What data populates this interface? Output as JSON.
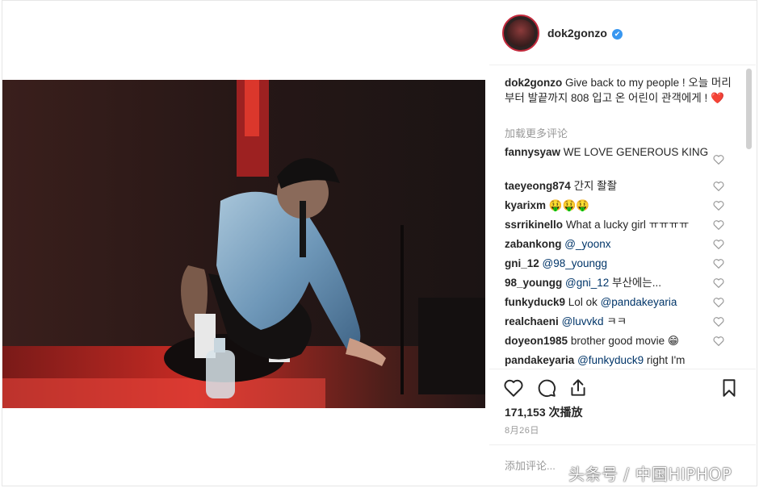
{
  "post": {
    "username": "dok2gonzo",
    "verified_mark": "✔",
    "caption_user": "dok2gonzo",
    "caption_text": "Give back to my people ! 오늘 머리 부터 발끝까지 808 입고 온 어린이 관객에게 !",
    "caption_emoji": "❤️",
    "load_more": "加载更多评论",
    "views": "171,153 次播放",
    "date": "8月26日",
    "add_comment_placeholder": "添加评论..."
  },
  "comments": [
    {
      "user": "fannysyaw",
      "text": "WE LOVE GENEROUS KING"
    },
    {
      "user": "taeyeong874",
      "text": "간지 좔좔"
    },
    {
      "user": "kyarixm",
      "text": "🤑🤑🤑"
    },
    {
      "user": "ssrrikinello",
      "text": "What a lucky girl ㅠㅠㅠㅠ"
    },
    {
      "user": "zabankong",
      "mention": "@_yoonx",
      "text": ""
    },
    {
      "user": "gni_12",
      "mention": "@98_youngg",
      "text": ""
    },
    {
      "user": "98_youngg",
      "mention": "@gni_12",
      "text": "부산에는..."
    },
    {
      "user": "funkyduck9",
      "pre": "Lol ok",
      "mention": "@pandakeyaria",
      "text": ""
    },
    {
      "user": "realchaeni",
      "mention": "@luvvkd",
      "text": "ㅋㅋ"
    },
    {
      "user": "doyeon1985",
      "text": "brother good movie 😁"
    },
    {
      "user": "pandakeyaria",
      "mention": "@funkyduck9",
      "text": "right I'm"
    }
  ],
  "icons": {
    "like": "heart-outline-icon",
    "comment": "comment-bubble-icon",
    "share": "share-icon",
    "save": "bookmark-icon",
    "verified": "verified-badge-icon"
  },
  "colors": {
    "verified": "#3897f0",
    "mention": "#003569",
    "muted": "#999999",
    "heart": "#e0245e"
  },
  "watermark": "头条号 / 中国HIPHOP"
}
